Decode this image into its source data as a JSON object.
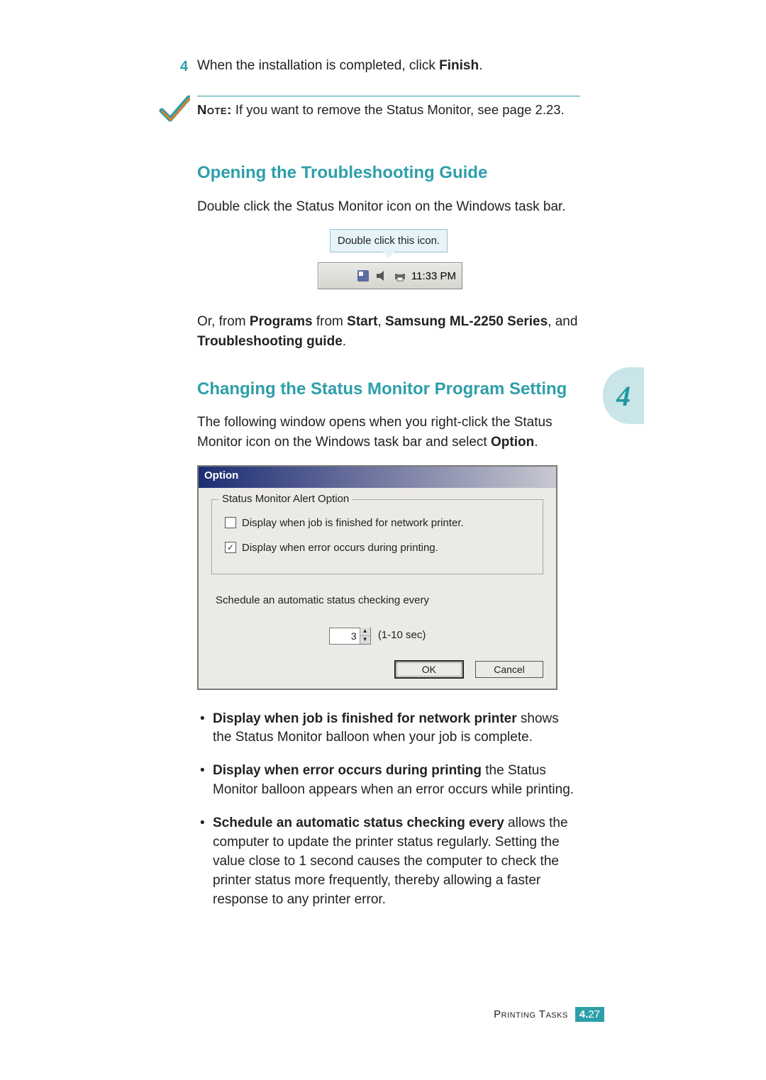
{
  "step": {
    "number": "4",
    "text_pre": "When the installation is completed, click ",
    "text_bold": "Finish",
    "text_post": "."
  },
  "note": {
    "label": "Note:",
    "text": " If you want to remove the Status Monitor, see page 2.23."
  },
  "section1": {
    "heading": "Opening the Troubleshooting Guide",
    "intro": "Double click the Status Monitor icon on the Windows task bar.",
    "tooltip": "Double click this icon.",
    "systray_time": "11:33 PM",
    "alt_path_pre": "Or, from ",
    "alt_b1": "Programs",
    "alt_mid1": " from ",
    "alt_b2": "Start",
    "alt_mid2": ", ",
    "alt_b3": "Samsung ML-2250 Series",
    "alt_mid3": ", and ",
    "alt_b4": "Troubleshooting guide",
    "alt_post": "."
  },
  "section2": {
    "heading": "Changing the Status Monitor Program Setting",
    "intro_pre": "The following window opens when you right-click the Status Monitor icon on the Windows task bar and select ",
    "intro_bold": "Option",
    "intro_post": "."
  },
  "dialog": {
    "title": "Option",
    "group_legend": "Status Monitor Alert Option",
    "chk1_label": "Display when job is finished for network printer.",
    "chk1_checked": false,
    "chk2_label": "Display when error occurs during printing.",
    "chk2_checked": true,
    "schedule_label": "Schedule an automatic status checking every",
    "spin_value": "3",
    "spin_range": "(1-10 sec)",
    "ok": "OK",
    "cancel": "Cancel"
  },
  "bullets": {
    "b1_bold": "Display when job is finished for network printer",
    "b1_rest": " shows the Status Monitor balloon when your job is complete.",
    "b2_bold": "Display when error occurs during printing",
    "b2_rest": " the Status Monitor balloon appears when an error occurs while printing.",
    "b3_bold": "Schedule an automatic status checking every",
    "b3_rest": " allows the computer to update the printer status regularly. Setting the value close to 1 second causes the computer to check the printer status more frequently, thereby allowing a faster response to any printer error."
  },
  "side_tab": "4",
  "footer": {
    "label": "Printing Tasks",
    "chapter": "4.",
    "page": "27"
  }
}
